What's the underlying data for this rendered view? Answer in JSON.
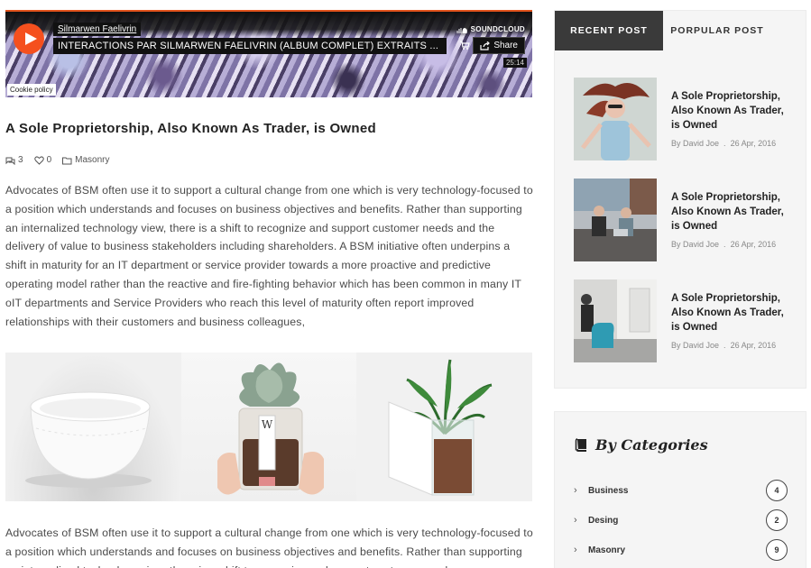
{
  "player": {
    "artist": "Silmarwen Faelivrin",
    "track": "INTERACTIONS PAR SILMARWEN FAELIVRIN (ALBUM COMPLET) EXTRAITS ...",
    "brand": "SOUNDCLOUD",
    "share_label": "Share",
    "duration": "25:14",
    "cookie_label": "Cookie policy",
    "accent_color": "#f5501e"
  },
  "post": {
    "title": "A Sole Proprietorship, Also Known As Trader, is Owned",
    "comments": "3",
    "likes": "0",
    "category": "Masonry",
    "paragraph_1": "Advocates of BSM often use it to support a cultural change from one which is very technology-focused to a position which understands and focuses on business objectives and benefits. Rather than supporting an internalized technology view, there is a shift to recognize and support customer needs and the delivery of value to business stakeholders including shareholders. A BSM initiative often underpins a shift in maturity for an IT department or service provider towards a more proactive and predictive operating model rather than the reactive and fire-fighting behavior which has been common in many IT oIT departments and Service Providers who reach this level of maturity often report improved relationships with their customers and business colleagues,",
    "paragraph_2": "Advocates of BSM often use it to support a cultural change from one which is very technology-focused to a position which understands and focuses on business objectives and benefits. Rather than supporting an internalized technology view, there is a shift to recognize and support customer needs",
    "jar_label": "W",
    "gallery": [
      "bowl-photo",
      "succulent-jar-photo",
      "plant-box-photo"
    ]
  },
  "sidebar": {
    "tabs": [
      {
        "label": "RECENT POST"
      },
      {
        "label": "PORPULAR POST"
      }
    ],
    "recent_posts": [
      {
        "title": "A Sole Proprietorship, Also Known As Trader, is Owned",
        "author": "By David Joe",
        "date": "26 Apr, 2016"
      },
      {
        "title": "A Sole Proprietorship, Also Known As Trader, is Owned",
        "author": "By David Joe",
        "date": "26 Apr, 2016"
      },
      {
        "title": "A Sole Proprietorship, Also Known As Trader, is Owned",
        "author": "By David Joe",
        "date": "26 Apr, 2016"
      }
    ],
    "categories_title": "By Categories",
    "categories": [
      {
        "name": "Business",
        "count": "4"
      },
      {
        "name": "Desing",
        "count": "2"
      },
      {
        "name": "Masonry",
        "count": "9"
      }
    ]
  }
}
